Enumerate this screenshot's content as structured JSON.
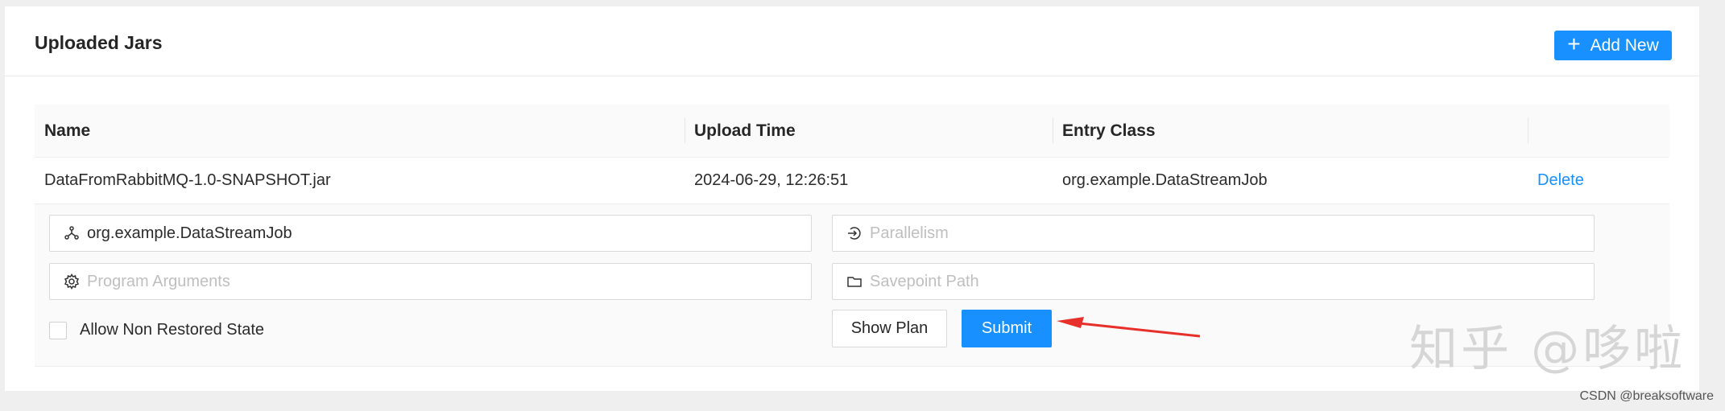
{
  "header": {
    "title": "Uploaded Jars",
    "add_button": {
      "icon": "plus-icon",
      "label": "Add New"
    }
  },
  "table": {
    "columns": [
      "Name",
      "Upload Time",
      "Entry Class",
      ""
    ],
    "rows": [
      {
        "name": "DataFromRabbitMQ-1.0-SNAPSHOT.jar",
        "upload_time": "2024-06-29, 12:26:51",
        "entry_class": "org.example.DataStreamJob",
        "action": "Delete"
      }
    ]
  },
  "form": {
    "entry_class": {
      "value": "org.example.DataStreamJob",
      "placeholder": "",
      "icon": "cluster-icon"
    },
    "parallelism": {
      "value": "",
      "placeholder": "Parallelism",
      "icon": "login-icon"
    },
    "program_arguments": {
      "value": "",
      "placeholder": "Program Arguments",
      "icon": "gear-icon"
    },
    "savepoint_path": {
      "value": "",
      "placeholder": "Savepoint Path",
      "icon": "folder-icon"
    },
    "allow_non_restored": {
      "label": "Allow Non Restored State",
      "checked": false
    },
    "show_plan_label": "Show Plan",
    "submit_label": "Submit"
  },
  "watermarks": {
    "zhihu": "知乎 @哆啦",
    "csdn": "CSDN @breaksoftware"
  },
  "colors": {
    "primary": "#1890ff",
    "annotation_arrow": "#e8302a"
  }
}
